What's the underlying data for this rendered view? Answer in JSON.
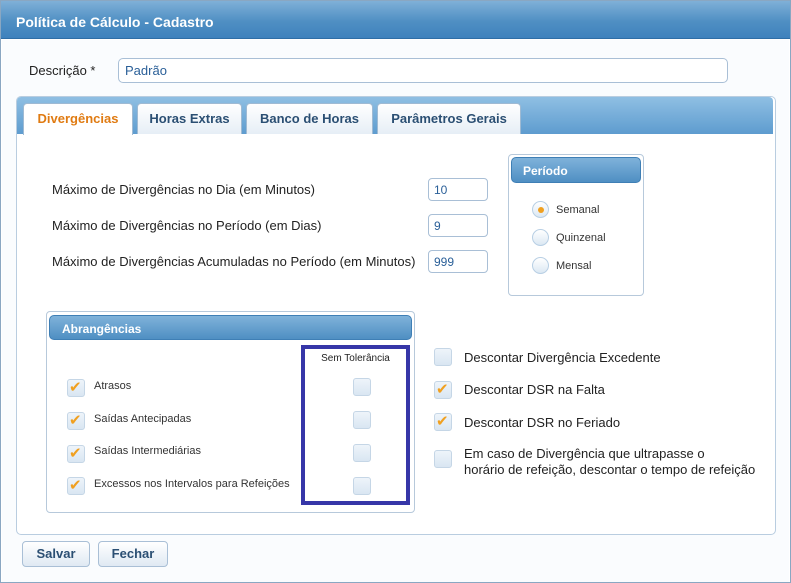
{
  "window": {
    "title": "Política de Cálculo - Cadastro"
  },
  "descricao": {
    "label": "Descrição *",
    "value": "Padrão"
  },
  "tabs": [
    {
      "label": "Divergências",
      "active": true
    },
    {
      "label": "Horas Extras",
      "active": false
    },
    {
      "label": "Banco de Horas",
      "active": false
    },
    {
      "label": "Parâmetros Gerais",
      "active": false
    }
  ],
  "fields": [
    {
      "label": "Máximo de Divergências no Dia (em Minutos)",
      "value": "10"
    },
    {
      "label": "Máximo de Divergências no Período (em Dias)",
      "value": "9"
    },
    {
      "label": "Máximo de Divergências Acumuladas no Período (em Minutos)",
      "value": "999"
    }
  ],
  "periodo": {
    "title": "Período",
    "options": [
      {
        "label": "Semanal",
        "selected": true
      },
      {
        "label": "Quinzenal",
        "selected": false
      },
      {
        "label": "Mensal",
        "selected": false
      }
    ]
  },
  "abrangencias": {
    "title": "Abrangências",
    "column_header": "Sem Tolerância",
    "items": [
      {
        "label": "Atrasos",
        "checked": true,
        "sem_tolerancia": false
      },
      {
        "label": "Saídas Antecipadas",
        "checked": true,
        "sem_tolerancia": false
      },
      {
        "label": "Saídas Intermediárias",
        "checked": true,
        "sem_tolerancia": false
      },
      {
        "label": "Excessos nos Intervalos para Refeições",
        "checked": true,
        "sem_tolerancia": false
      }
    ]
  },
  "options": [
    {
      "label": "Descontar Divergência Excedente",
      "checked": false
    },
    {
      "label": "Descontar DSR na Falta",
      "checked": true
    },
    {
      "label": "Descontar DSR no Feriado",
      "checked": true
    },
    {
      "label_line1": "Em caso de Divergência que ultrapasse o",
      "label_line2": "horário de refeição, descontar o tempo de refeição",
      "checked": false
    }
  ],
  "buttons": {
    "save": "Salvar",
    "close": "Fechar"
  },
  "colors": {
    "accent": "#e07b12",
    "check": "#f0a020",
    "header_blue": "#4f8fc3",
    "highlight_border": "#3636a8"
  }
}
